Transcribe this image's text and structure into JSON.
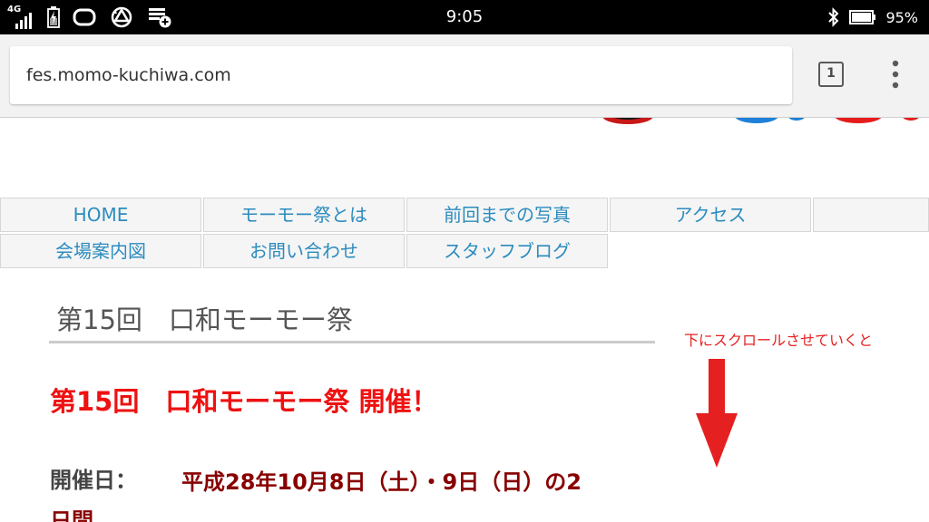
{
  "status_bar": {
    "network_type": "4G",
    "time": "9:05",
    "battery_percent": "95%",
    "icons": [
      "signal-icon",
      "battery-charging-icon",
      "app-notification-icon",
      "sync-notification-icon",
      "app-add-notification-icon",
      "bluetooth-icon",
      "battery-icon"
    ]
  },
  "browser": {
    "url": "fes.momo-kuchiwa.com",
    "tab_count": "1",
    "menu_icon": "more-vert-icon"
  },
  "nav": {
    "items": [
      {
        "label": "HOME"
      },
      {
        "label": "モーモー祭とは"
      },
      {
        "label": "前回までの写真"
      },
      {
        "label": "アクセス"
      },
      {
        "label": ""
      },
      {
        "label": "会場案内図"
      },
      {
        "label": "お問い合わせ"
      },
      {
        "label": "スタッフブログ"
      }
    ]
  },
  "content": {
    "page_title": "第15回　口和モーモー祭",
    "headline": "第15回　口和モーモー祭 開催！",
    "date_label": "開催日：",
    "date_value": "平成28年10月8日（土）・9日（日）の2",
    "date_value_cont": "日間"
  },
  "annotation": {
    "text": "下にスクロールさせていくと",
    "arrow_icon": "down-arrow-icon"
  },
  "colors": {
    "status_bar_bg": "#000000",
    "toolbar_bg": "#f2f2f2",
    "nav_link": "#2c8cbf",
    "headline": "#ee1111",
    "date_value": "#880000",
    "annotation": "#e52020"
  }
}
